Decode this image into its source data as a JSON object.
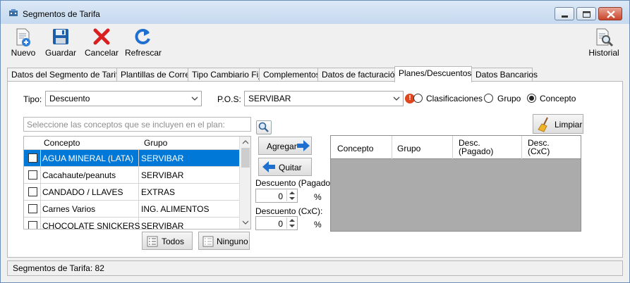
{
  "window": {
    "title": "Segmentos de Tarifa"
  },
  "toolbar": {
    "nuevo": "Nuevo",
    "guardar": "Guardar",
    "cancelar": "Cancelar",
    "refrescar": "Refrescar",
    "historial": "Historial"
  },
  "tabs": [
    {
      "label": "Datos del Segmento de Tarifa"
    },
    {
      "label": "Plantillas de Correo"
    },
    {
      "label": "Tipo Cambiario Fijo"
    },
    {
      "label": "Complementos"
    },
    {
      "label": "Datos de facturación"
    },
    {
      "label": "Planes/Descuentos"
    },
    {
      "label": "Datos Bancarios"
    }
  ],
  "form": {
    "tipo_label": "Tipo:",
    "tipo_value": "Descuento",
    "pos_label": "P.O.S:",
    "pos_value": "SERVIBAR",
    "radio_clasificaciones": "Clasificaciones",
    "radio_grupo": "Grupo",
    "radio_concepto": "Concepto",
    "radio_selected": "Concepto",
    "search_placeholder": "Seleccione las conceptos que se incluyen en el plan:",
    "limpiar": "Limpiar"
  },
  "left_grid": {
    "headers": [
      "Concepto",
      "Grupo"
    ],
    "rows": [
      {
        "concepto": "AGUA MINERAL (LATA)",
        "grupo": "SERVIBAR",
        "selected": true
      },
      {
        "concepto": "Cacahaute/peanuts",
        "grupo": "SERVIBAR",
        "selected": false
      },
      {
        "concepto": "CANDADO / LLAVES",
        "grupo": "EXTRAS",
        "selected": false
      },
      {
        "concepto": "Carnes Varios",
        "grupo": "ING. ALIMENTOS",
        "selected": false
      },
      {
        "concepto": "CHOCOLATE SNICKERS",
        "grupo": "SERVIBAR",
        "selected": false
      }
    ]
  },
  "middle": {
    "agregar": "Agregar",
    "quitar": "Quitar",
    "descuento_pagado_label": "Descuento (Pagado):",
    "descuento_pagado_value": "0",
    "descuento_cxc_label": "Descuento (CxC):",
    "descuento_cxc_value": "0",
    "percent": "%"
  },
  "bottom_buttons": {
    "todos": "Todos",
    "ninguno": "Ninguno"
  },
  "right_grid": {
    "headers": [
      "Concepto",
      "Grupo",
      "Desc.\n(Pagado)",
      "Desc.\n(CxC)"
    ]
  },
  "status": {
    "text": "Segmentos de Tarifa: 82"
  }
}
